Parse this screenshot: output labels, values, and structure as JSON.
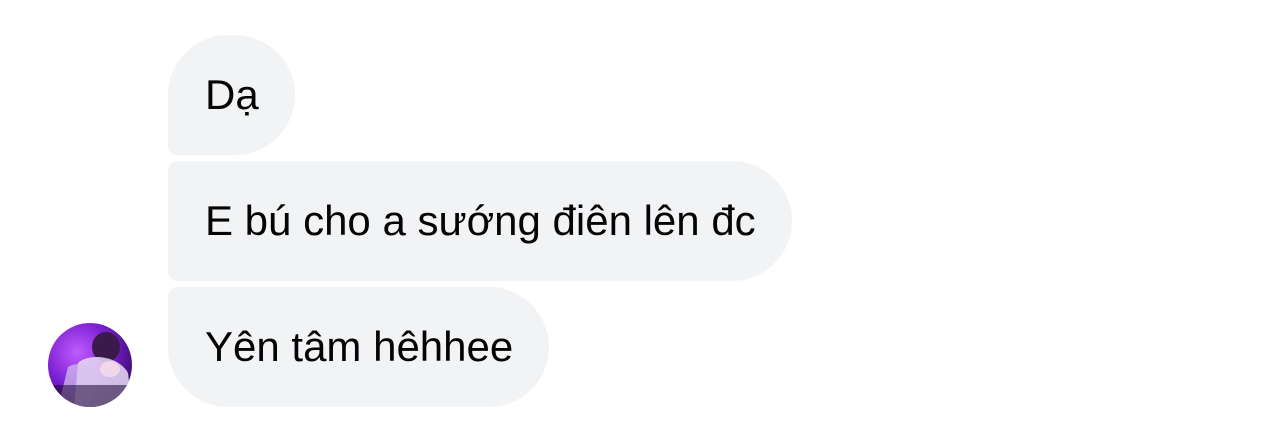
{
  "conversation": {
    "messages": [
      {
        "text": "Dạ"
      },
      {
        "text": "E bú cho a sướng điên lên đc"
      },
      {
        "text": "Yên tâm hêhhee"
      }
    ]
  },
  "sender": {
    "avatar_icon": "profile-photo-icon"
  },
  "colors": {
    "bubble_background": "#f2f3f5",
    "text": "#050505",
    "page_background": "#ffffff",
    "avatar_primary": "#8a2be2"
  }
}
